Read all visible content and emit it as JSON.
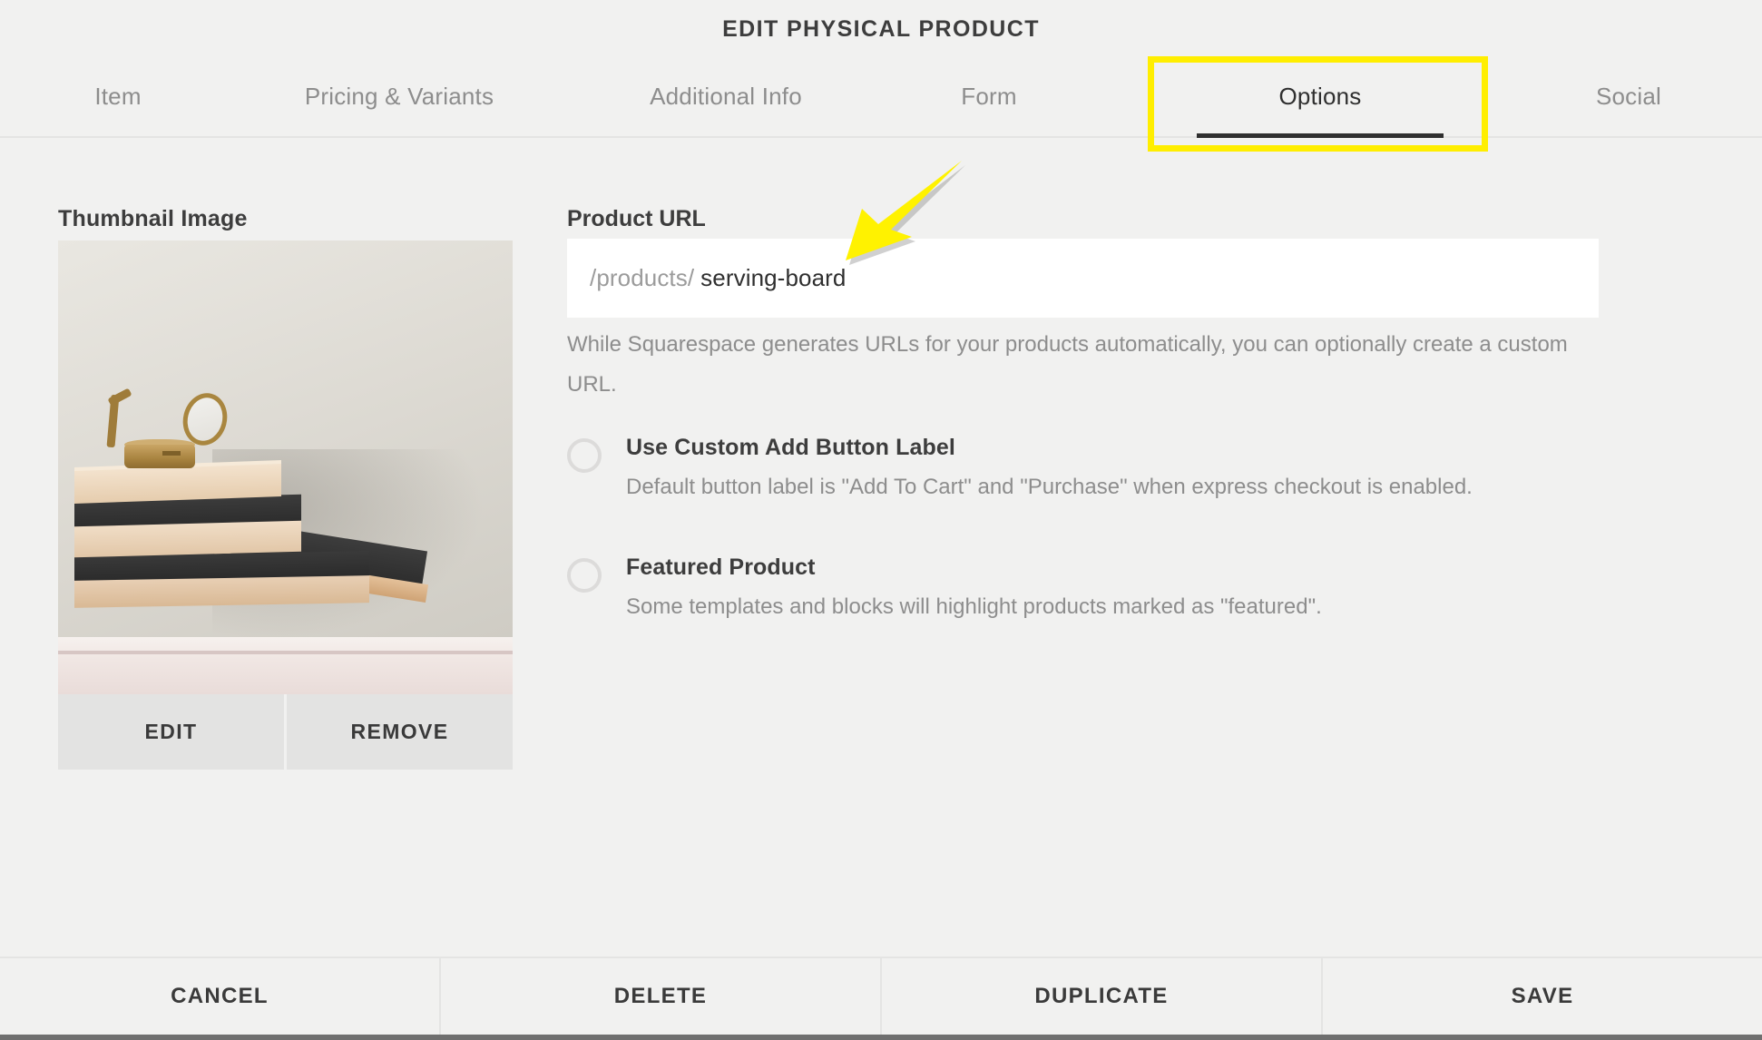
{
  "window": {
    "title": "EDIT PHYSICAL PRODUCT"
  },
  "tabs": [
    {
      "id": "item",
      "label": "Item",
      "active": false
    },
    {
      "id": "pricing",
      "label": "Pricing & Variants",
      "active": false
    },
    {
      "id": "additional",
      "label": "Additional Info",
      "active": false
    },
    {
      "id": "form",
      "label": "Form",
      "active": false
    },
    {
      "id": "options",
      "label": "Options",
      "active": true
    },
    {
      "id": "social",
      "label": "Social",
      "active": false
    }
  ],
  "annotations": {
    "highlight_color": "#ffee00",
    "highlight_target": "Options",
    "arrow_color": "#fff200",
    "arrow_target": "Product URL"
  },
  "thumbnail": {
    "label": "Thumbnail Image",
    "edit_label": "EDIT",
    "remove_label": "REMOVE",
    "image_description": "Stacked wooden and black serving boards with a brass compass on top against a white wall"
  },
  "product_url": {
    "label": "Product URL",
    "prefix": "/products/",
    "value": "serving-board",
    "help": "While Squarespace generates URLs for your products automatically, you can optionally create a custom URL."
  },
  "options": [
    {
      "id": "custom-add-button-label",
      "title": "Use Custom Add Button Label",
      "description": "Default button label is \"Add To Cart\" and \"Purchase\" when express checkout is enabled.",
      "checked": false
    },
    {
      "id": "featured-product",
      "title": "Featured Product",
      "description": "Some templates and blocks will highlight products marked as \"featured\".",
      "checked": false
    }
  ],
  "action_bar": {
    "cancel_label": "CANCEL",
    "delete_label": "DELETE",
    "duplicate_label": "DUPLICATE",
    "save_label": "SAVE"
  },
  "colors": {
    "background": "#f1f1f0",
    "text_primary": "#3d3d3d",
    "text_muted": "#8d8d8d",
    "input_background": "#ffffff",
    "divider": "#e4e4e3",
    "accent_annotation": "#ffee00"
  }
}
